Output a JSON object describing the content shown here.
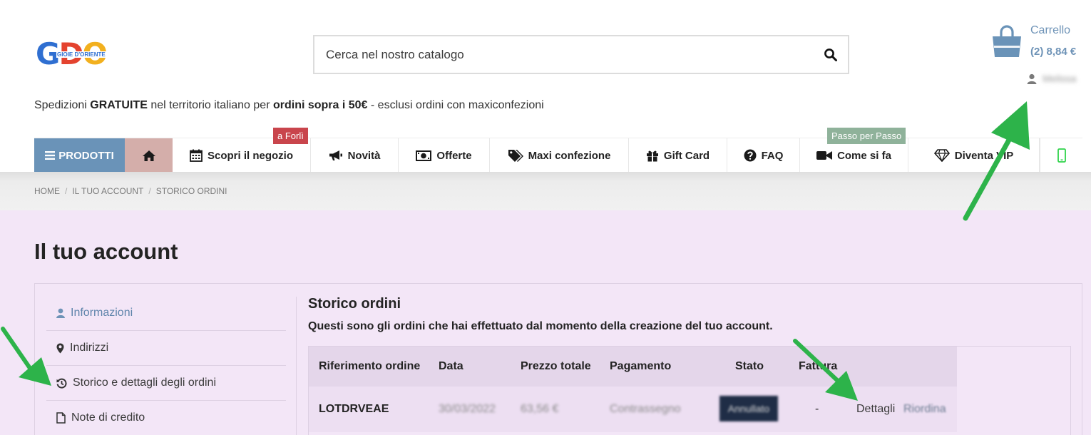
{
  "logo": {
    "letters": [
      "G",
      "D",
      "O"
    ],
    "subtitle": "GIOIE D'ORIENTE"
  },
  "search": {
    "placeholder": "Cerca nel nostro catalogo",
    "icon": "search-icon"
  },
  "cart": {
    "label": "Carrello",
    "total": "(2) 8,84 €"
  },
  "user": {
    "name": "Melissa"
  },
  "shipping_banner": {
    "part1": "Spedizioni ",
    "bold1": "GRATUITE",
    "part2": " nel territorio italiano per ",
    "bold2": "ordini sopra i 50€",
    "part3": " - esclusi ordini con maxiconfezioni"
  },
  "nav": {
    "products": "PRODOTTI",
    "items": [
      {
        "label": "Scopri il negozio",
        "icon": "calendar-icon"
      },
      {
        "label": "Novità",
        "icon": "megaphone-icon"
      },
      {
        "label": "Offerte",
        "icon": "money-icon"
      },
      {
        "label": "Maxi confezione",
        "icon": "tags-icon"
      },
      {
        "label": "Gift Card",
        "icon": "gift-icon"
      },
      {
        "label": "FAQ",
        "icon": "question-icon"
      },
      {
        "label": "Come si fa",
        "icon": "video-icon"
      },
      {
        "label": "Diventa VIP",
        "icon": "diamond-icon"
      }
    ],
    "badges": {
      "store": "a Forlì",
      "howto": "Passo per Passo"
    }
  },
  "breadcrumb": [
    "HOME",
    "IL TUO ACCOUNT",
    "STORICO ORDINI"
  ],
  "account": {
    "title": "Il tuo account",
    "sidebar": [
      {
        "label": "Informazioni",
        "icon": "user-icon"
      },
      {
        "label": "Indirizzi",
        "icon": "map-pin-icon"
      },
      {
        "label": "Storico e dettagli degli ordini",
        "icon": "history-icon"
      },
      {
        "label": "Note di credito",
        "icon": "file-icon"
      }
    ]
  },
  "orders": {
    "title": "Storico ordini",
    "description": "Questi sono gli ordini che hai effettuato dal momento della creazione del tuo account.",
    "columns": [
      "Riferimento ordine",
      "Data",
      "Prezzo totale",
      "Pagamento",
      "Stato",
      "Fattura"
    ],
    "rows": [
      {
        "reference": "LOTDRVEAE",
        "date": "30/03/2022",
        "total": "63,56 €",
        "payment": "Contrassegno",
        "status": "Annullato",
        "invoice": "-",
        "details": "Dettagli",
        "reorder": "Riordina"
      }
    ]
  },
  "colors": {
    "accent_blue": "#6a93b8",
    "home_pink": "#d4aeaa",
    "badge_red": "#c9454c",
    "badge_green": "#8fb29a",
    "account_bg": "#f3e6f7",
    "annotation_arrow": "#2db34a"
  }
}
